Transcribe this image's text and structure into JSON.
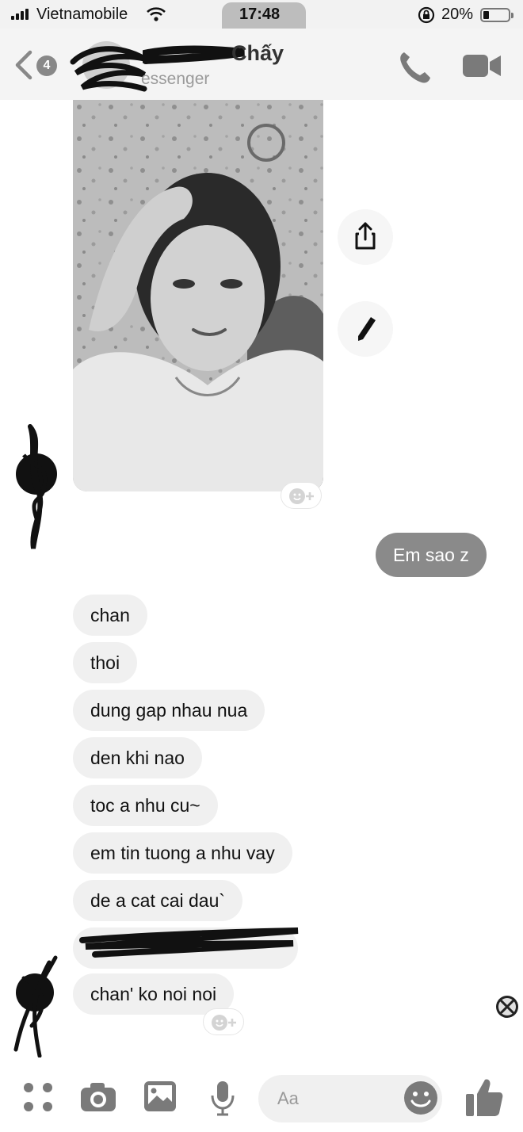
{
  "status_bar": {
    "carrier": "Vietnamobile",
    "time": "17:48",
    "battery": "20%"
  },
  "header": {
    "back_count": "4",
    "contact_name_visible": "Chấy",
    "subtitle_visible": "essenger"
  },
  "messages": {
    "sent": [
      {
        "text": "Em sao z"
      }
    ],
    "received": [
      {
        "text": "chan"
      },
      {
        "text": "thoi"
      },
      {
        "text": "dung gap nhau nua"
      },
      {
        "text": "den khi nao"
      },
      {
        "text": "toc a nhu cu~"
      },
      {
        "text": "em tin tuong a nhu vay"
      },
      {
        "text": "de a cat cai dau`"
      },
      {
        "text": "chan' ko noi noi"
      }
    ]
  },
  "composer": {
    "placeholder": "Aa"
  },
  "icons": [
    "signal-icon",
    "wifi-icon",
    "rotation-lock-icon",
    "battery-icon",
    "back-chevron-icon",
    "phone-icon",
    "video-camera-icon",
    "share-icon",
    "pencil-icon",
    "emoji-plus-icon",
    "apps-grid-icon",
    "camera-icon",
    "image-icon",
    "microphone-icon",
    "smiley-icon",
    "thumbs-up-icon"
  ],
  "colors": {
    "sent_bubble": "#8a8a8a",
    "received_bubble": "#f0f0f0",
    "icon": "#7a7a7a"
  }
}
